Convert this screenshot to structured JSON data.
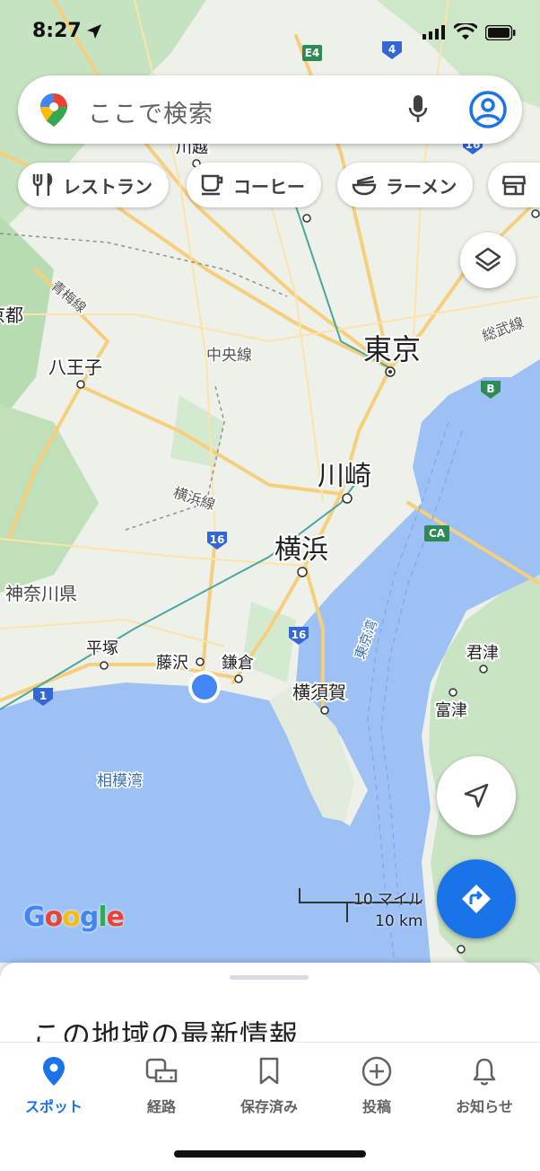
{
  "status": {
    "time": "8:27"
  },
  "search": {
    "placeholder": "ここで検索"
  },
  "chips": [
    "レストラン",
    "コーヒー",
    "ラーメン"
  ],
  "map": {
    "places": {
      "tokyo": "東京",
      "kawasaki": "川崎",
      "yokohama": "横浜",
      "hachioji": "八王子",
      "kamakura": "鎌倉",
      "fujisawa": "藤沢",
      "hiratsuka": "平塚",
      "yokosuka": "横須賀",
      "kimitsu": "君津",
      "futtsu": "富津",
      "kawagoe": "川越",
      "tokyo_to": "京都",
      "kanagawa": "神奈川県",
      "sagami_bay": "相模湾",
      "tokyo_bay": "東京湾",
      "ome_line": "青梅線",
      "chuo_line": "中央線",
      "yokohama_line": "横浜線",
      "sobu_line": "総武線"
    },
    "shields": [
      "E4",
      "4",
      "16",
      "16",
      "16",
      "1",
      "CA",
      "B"
    ],
    "scale": {
      "imperial": "10 マイル",
      "metric": "10 km"
    },
    "logo": "Google"
  },
  "sheet": {
    "title": "この地域の最新情報"
  },
  "nav": [
    {
      "label": "スポット",
      "active": true
    },
    {
      "label": "経路",
      "active": false
    },
    {
      "label": "保存済み",
      "active": false
    },
    {
      "label": "投稿",
      "active": false
    },
    {
      "label": "お知らせ",
      "active": false
    }
  ],
  "colors": {
    "accent": "#1a73e8",
    "water": "#9dc1f5",
    "land": "#eef0ea",
    "green": "#c5e3c0",
    "road": "#f7d58b"
  },
  "icons": [
    "location-arrow-icon",
    "signal-icon",
    "wifi-icon",
    "battery-icon",
    "maps-pin-icon",
    "mic-icon",
    "account-icon",
    "fork-knife-icon",
    "coffee-icon",
    "ramen-icon",
    "layers-icon",
    "navigation-icon",
    "directions-icon",
    "explore-pin-icon",
    "commute-icon",
    "bookmark-icon",
    "add-circle-icon",
    "bell-icon"
  ]
}
